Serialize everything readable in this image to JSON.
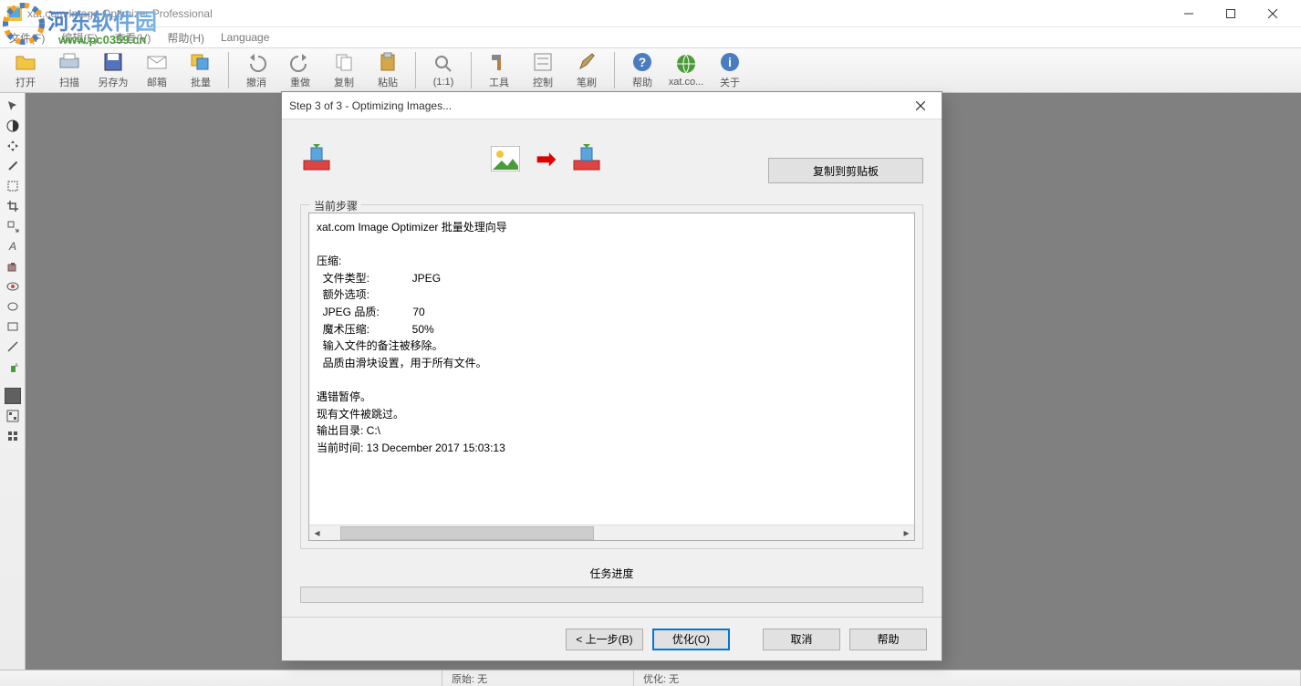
{
  "app": {
    "title": "xat.com  Image Optimizer Professional"
  },
  "menu": {
    "file": "文件(F)",
    "edit": "编辑(E)",
    "view": "查看(V)",
    "help": "帮助(H)",
    "language": "Language"
  },
  "toolbar": {
    "open": "打开",
    "scan": "扫描",
    "saveas": "另存为",
    "mail": "邮箱",
    "batch": "批量",
    "undo": "撤消",
    "redo": "重做",
    "copy": "复制",
    "paste": "粘贴",
    "one2one": "(1:1)",
    "tools": "工具",
    "control": "控制",
    "brush": "笔刷",
    "help": "帮助",
    "xat": "xat.co...",
    "about": "关于"
  },
  "status": {
    "original": "原始: 无",
    "optimize": "优化: 无"
  },
  "dialog": {
    "title": "Step 3 of 3 - Optimizing Images...",
    "copy_btn": "复制到剪贴板",
    "fieldset": "当前步骤",
    "text": "xat.com Image Optimizer 批量处理向导\n\n压缩:\n  文件类型:              JPEG\n  额外选项:\n  JPEG 品质:           70\n  魔术压缩:              50%\n  输入文件的备注被移除。\n  品质由滑块设置，用于所有文件。\n\n遇错暂停。\n现有文件被跳过。\n输出目录: C:\\\n当前时间: 13 December 2017 15:03:13",
    "progress_label": "任务进度",
    "back": "< 上一步(B)",
    "optimize": "优化(O)",
    "cancel": "取消",
    "help": "帮助"
  },
  "watermark": {
    "text": "河东软件园",
    "url": "www.pc0359.cn"
  }
}
